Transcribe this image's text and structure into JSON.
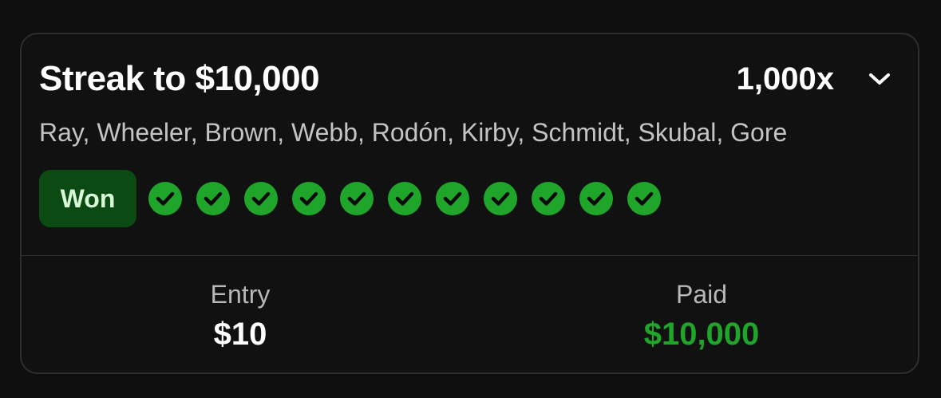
{
  "card": {
    "title": "Streak to $10,000",
    "multiplier": "1,000x",
    "players": "Ray, Wheeler, Brown, Webb, Rodón, Kirby, Schmidt, Skubal, Gore",
    "status": "Won",
    "checks_count": 11,
    "checks_icon": "check-circle-icon",
    "entry_label": "Entry",
    "entry_value": "$10",
    "paid_label": "Paid",
    "paid_value": "$10,000"
  },
  "colors": {
    "background": "#0f0f0f",
    "card": "#111111",
    "won_badge_bg": "#0c4a14",
    "check_green": "#1fa52a",
    "paid_green": "#1fa52a",
    "text_primary": "#ffffff",
    "text_secondary": "#c4c4c4"
  }
}
